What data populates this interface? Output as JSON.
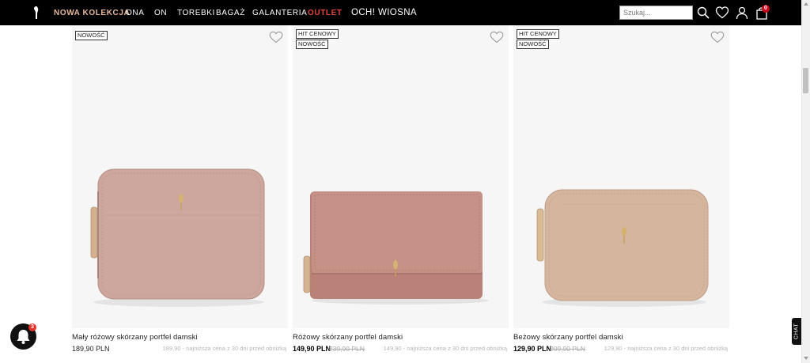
{
  "nav": {
    "items": [
      {
        "label": "NOWA KOLEKCJA",
        "style": "new"
      },
      {
        "label": "ONA",
        "style": "normal"
      },
      {
        "label": "ON",
        "style": "normal"
      },
      {
        "label": "TOREBKI",
        "style": "normal"
      },
      {
        "label": "BAGAŻ",
        "style": "normal"
      },
      {
        "label": "GALANTERIA",
        "style": "normal"
      },
      {
        "label": "OUTLET",
        "style": "outlet"
      },
      {
        "label": "OCH! WIOSNA",
        "style": "promo"
      }
    ],
    "search_placeholder": "Szukaj...",
    "cart_count": "0",
    "icons": [
      "logo-icon",
      "search-icon",
      "heart-icon",
      "user-icon",
      "bag-icon"
    ]
  },
  "products": [
    {
      "badges": [
        "NOWOŚĆ"
      ],
      "name": "Mały różowy skórzany portfel damski",
      "price": "189,90 PLN",
      "old_price": "",
      "lowest_note": "189,90 - najniższa cena z 30 dni przed obniżką",
      "color": "#cda79e"
    },
    {
      "badges": [
        "HIT CENOWY",
        "NOWOŚĆ"
      ],
      "name": "Różowy skórzany portfel damski",
      "price": "149,90 PLN",
      "old_price": "239,90 PLN",
      "lowest_note": "149,90 - najniższa cena z 30 dni przed obniżką",
      "color": "#c69287"
    },
    {
      "badges": [
        "HIT CENOWY",
        "NOWOŚĆ"
      ],
      "name": "Beżowy skórzany portfel damski",
      "price": "129,90 PLN",
      "old_price": "209,90 PLN",
      "lowest_note": "129,90 - najniższa cena z 30 dni przed obniżką",
      "color": "#d6b59e"
    }
  ],
  "widgets": {
    "notification_count": "3",
    "chat_label": "CHAT"
  },
  "colors": {
    "header_bg": "#000000",
    "new_collection": "#e8b89a",
    "outlet": "#e0453a",
    "photo_bg": "#f6f6f6"
  }
}
